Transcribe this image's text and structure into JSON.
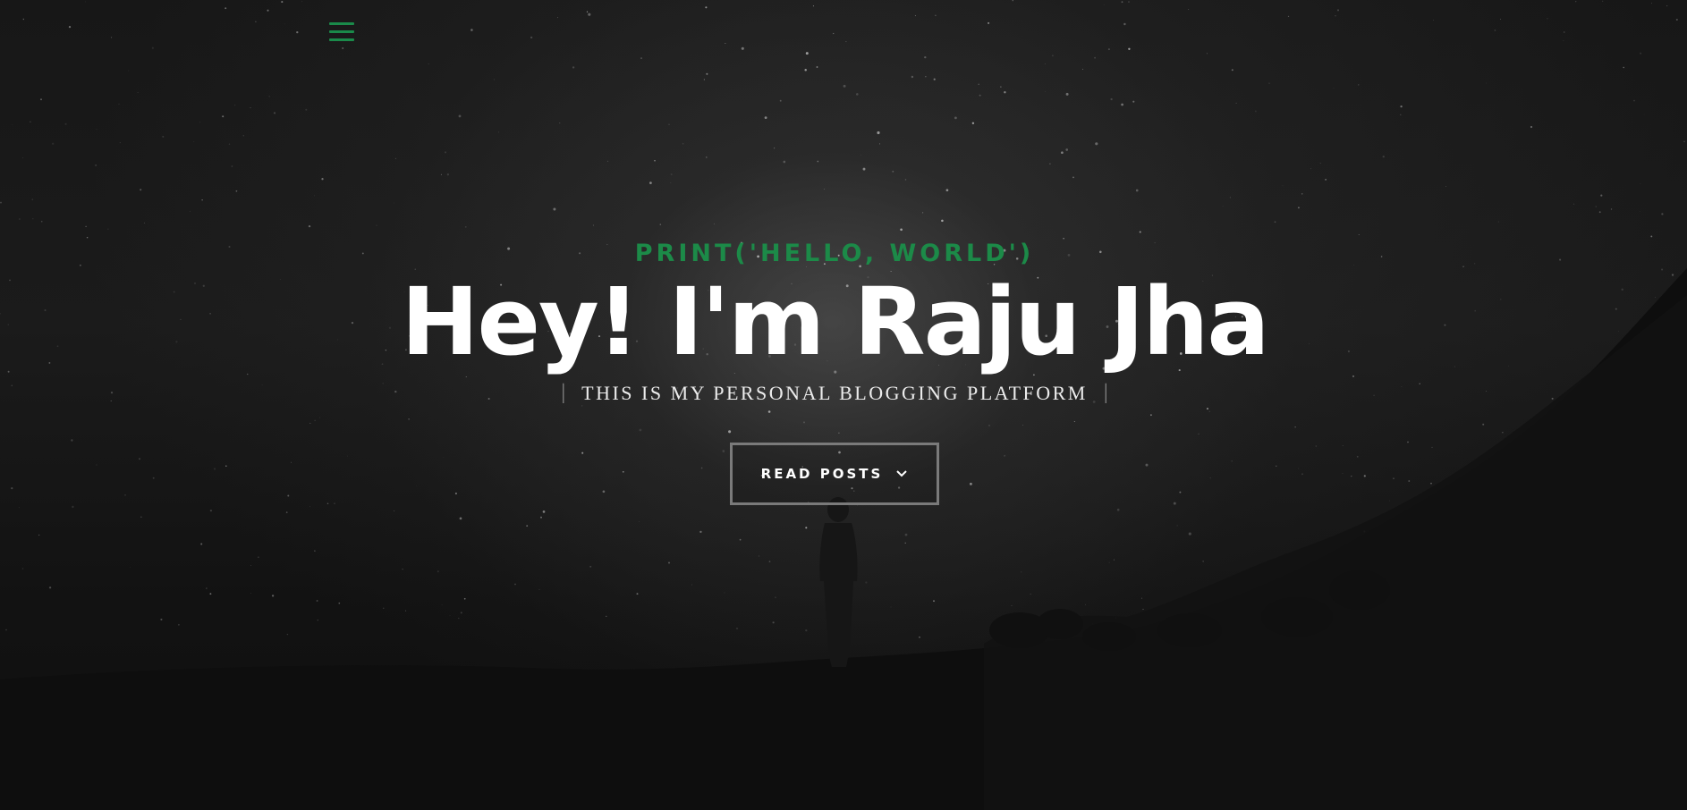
{
  "nav": {
    "menu_icon": "hamburger-menu-icon",
    "accent_color": "#1c8a48"
  },
  "hero": {
    "kicker": "PRINT('HELLO, WORLD')",
    "title": "Hey! I'm Raju Jha",
    "subtitle": "THIS IS MY PERSONAL BLOGGING PLATFORM",
    "divider_left": "|",
    "divider_right": "|",
    "cta_label": "READ POSTS",
    "cta_icon": "chevron-down-icon"
  },
  "colors": {
    "background": "#0f0f0f",
    "accent": "#1c8a48",
    "title": "#ffffff",
    "button_border": "#7a7a7a"
  }
}
